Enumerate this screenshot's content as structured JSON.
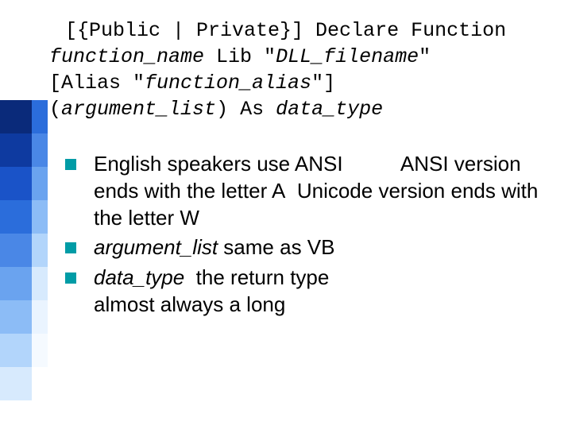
{
  "colors": {
    "accent": "#009ca6",
    "stair_dark": [
      "#0a2a7a",
      "#0e3aa0",
      "#1a53c8",
      "#2b6ddb",
      "#4a87e6",
      "#6aa3ef",
      "#8cbcf6",
      "#b2d5fb",
      "#d7eafd"
    ],
    "stair_light": [
      "#2b6ddb",
      "#4a87e6",
      "#6aa3ef",
      "#8cbcf6",
      "#b2d5fb",
      "#d7eafd",
      "#eaf4ff",
      "#f5faff",
      "#ffffff"
    ]
  },
  "code": {
    "l1_a": "[{Public | Private}] Declare Function",
    "l2_a": "function_name",
    "l2_b": " Lib \"",
    "l2_c": "DLL_filename",
    "l2_d": "\"",
    "l3_a": "[Alias \"",
    "l3_b": "function_alias",
    "l3_c": "\"]",
    "l4_a": "(",
    "l4_b": "argument_list",
    "l4_c": ") As ",
    "l4_d": "data_type"
  },
  "bullets": {
    "b1_a": "English speakers use ANSI",
    "b1_b": "ANSI version ends with the letter A",
    "b1_c": "Unicode version ends with the letter W",
    "b2_a": "argument_list",
    "b2_b": "  same as VB",
    "b3_a": "data_type",
    "b3_b": " the return type",
    "b3_c": "almost always a long"
  }
}
